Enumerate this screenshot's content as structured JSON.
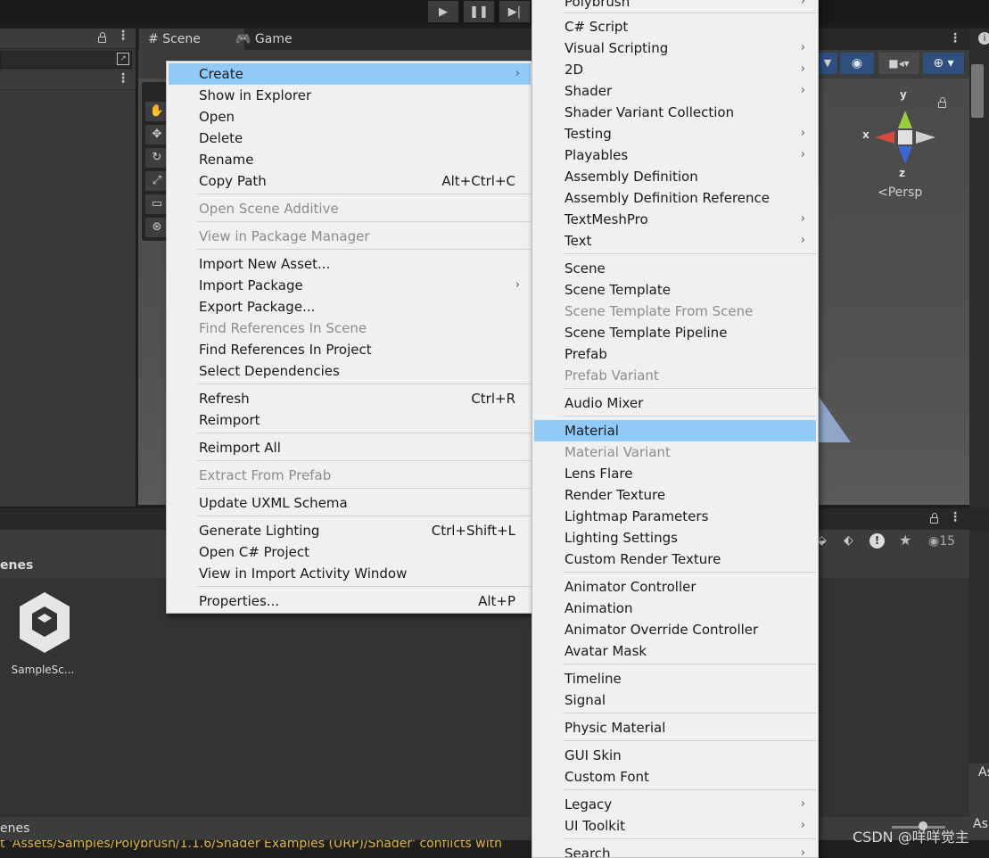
{
  "toolbar": {
    "play_icon": "play-icon",
    "pause_icon": "pause-icon",
    "step_icon": "step-icon"
  },
  "scene_tabs": [
    {
      "label": "Scene",
      "icon": "grid-icon"
    },
    {
      "label": "Game",
      "icon": "gamepad-icon"
    }
  ],
  "scene": {
    "persp_label": "Persp",
    "axis_x": "x",
    "axis_y": "y",
    "axis_z": "z"
  },
  "project": {
    "breadcrumb": "enes",
    "asset_name": "SampleSc...",
    "footer_breadcrumb": "enes",
    "hidden_count": "15"
  },
  "console_message": "t 'Assets/Samples/Polybrush/1.1.6/Shader Examples (URP)/Shader' conflicts with",
  "right_panel_label": "As",
  "right_panel_label2": "As",
  "watermark": "CSDN @咩咩觉主",
  "context_menu": {
    "items": [
      {
        "label": "Create",
        "arrow": true,
        "selected": true
      },
      {
        "label": "Show in Explorer"
      },
      {
        "label": "Open"
      },
      {
        "label": "Delete"
      },
      {
        "label": "Rename"
      },
      {
        "label": "Copy Path",
        "shortcut": "Alt+Ctrl+C"
      },
      {
        "label": "Open Scene Additive",
        "disabled": true
      },
      {
        "label": "View in Package Manager",
        "disabled": true
      },
      {
        "label": "Import New Asset..."
      },
      {
        "label": "Import Package",
        "arrow": true
      },
      {
        "label": "Export Package..."
      },
      {
        "label": "Find References In Scene",
        "disabled": true
      },
      {
        "label": "Find References In Project"
      },
      {
        "label": "Select Dependencies"
      },
      {
        "label": "Refresh",
        "shortcut": "Ctrl+R"
      },
      {
        "label": "Reimport"
      },
      {
        "label": "Reimport All"
      },
      {
        "label": "Extract From Prefab",
        "disabled": true
      },
      {
        "label": "Update UXML Schema"
      },
      {
        "label": "Generate Lighting",
        "shortcut": "Ctrl+Shift+L"
      },
      {
        "label": "Open C# Project"
      },
      {
        "label": "View in Import Activity Window"
      },
      {
        "label": "Properties...",
        "shortcut": "Alt+P"
      }
    ]
  },
  "create_submenu": {
    "items": [
      {
        "label": "Polybrush",
        "arrow": true
      },
      {
        "label": "C# Script"
      },
      {
        "label": "Visual Scripting",
        "arrow": true
      },
      {
        "label": "2D",
        "arrow": true
      },
      {
        "label": "Shader",
        "arrow": true
      },
      {
        "label": "Shader Variant Collection"
      },
      {
        "label": "Testing",
        "arrow": true
      },
      {
        "label": "Playables",
        "arrow": true
      },
      {
        "label": "Assembly Definition"
      },
      {
        "label": "Assembly Definition Reference"
      },
      {
        "label": "TextMeshPro",
        "arrow": true
      },
      {
        "label": "Text",
        "arrow": true
      },
      {
        "label": "Scene"
      },
      {
        "label": "Scene Template"
      },
      {
        "label": "Scene Template From Scene",
        "disabled": true
      },
      {
        "label": "Scene Template Pipeline"
      },
      {
        "label": "Prefab"
      },
      {
        "label": "Prefab Variant",
        "disabled": true
      },
      {
        "label": "Audio Mixer"
      },
      {
        "label": "Material",
        "selected": true
      },
      {
        "label": "Material Variant",
        "disabled": true
      },
      {
        "label": "Lens Flare"
      },
      {
        "label": "Render Texture"
      },
      {
        "label": "Lightmap Parameters"
      },
      {
        "label": "Lighting Settings"
      },
      {
        "label": "Custom Render Texture"
      },
      {
        "label": "Animator Controller"
      },
      {
        "label": "Animation"
      },
      {
        "label": "Animator Override Controller"
      },
      {
        "label": "Avatar Mask"
      },
      {
        "label": "Timeline"
      },
      {
        "label": "Signal"
      },
      {
        "label": "Physic Material"
      },
      {
        "label": "GUI Skin"
      },
      {
        "label": "Custom Font"
      },
      {
        "label": "Legacy",
        "arrow": true
      },
      {
        "label": "UI Toolkit",
        "arrow": true
      },
      {
        "label": "Search",
        "arrow": true
      }
    ]
  }
}
